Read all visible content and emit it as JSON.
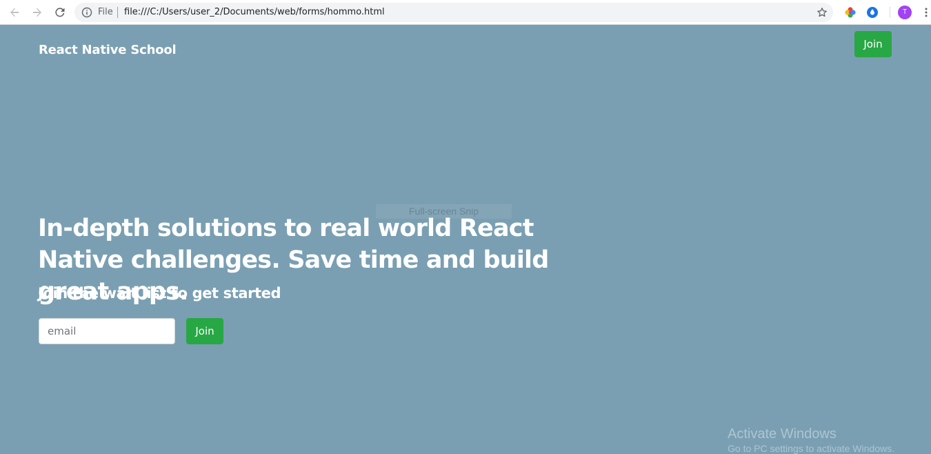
{
  "browser": {
    "scheme_label": "File",
    "url": "file:///C:/Users/user_2/Documents/web/forms/hommo.html",
    "profile_initial": "T",
    "icons": {
      "back": "back-arrow-icon",
      "forward": "forward-arrow-icon",
      "reload": "reload-icon",
      "info": "info-icon",
      "bookmark": "star-icon",
      "extension_1": "color-wheel-extension-icon",
      "extension_2": "blue-drop-extension-icon",
      "menu": "kebab-menu-icon"
    }
  },
  "header": {
    "brand": "React Native School",
    "join_label": "Join"
  },
  "hero": {
    "headline": "In-depth solutions to real world React Native challenges. Save time and build great apps.",
    "subheadline": "Join the wait list to get started"
  },
  "signup": {
    "email_placeholder": "email",
    "email_value": "",
    "join_label": "Join"
  },
  "overlays": {
    "snip_label": "Full-screen Snip",
    "windows_title": "Activate Windows",
    "windows_sub": "Go to PC settings to activate Windows."
  },
  "colors": {
    "page_background": "#7a9fb2",
    "button_green": "#28a745",
    "text_white": "#ffffff"
  }
}
